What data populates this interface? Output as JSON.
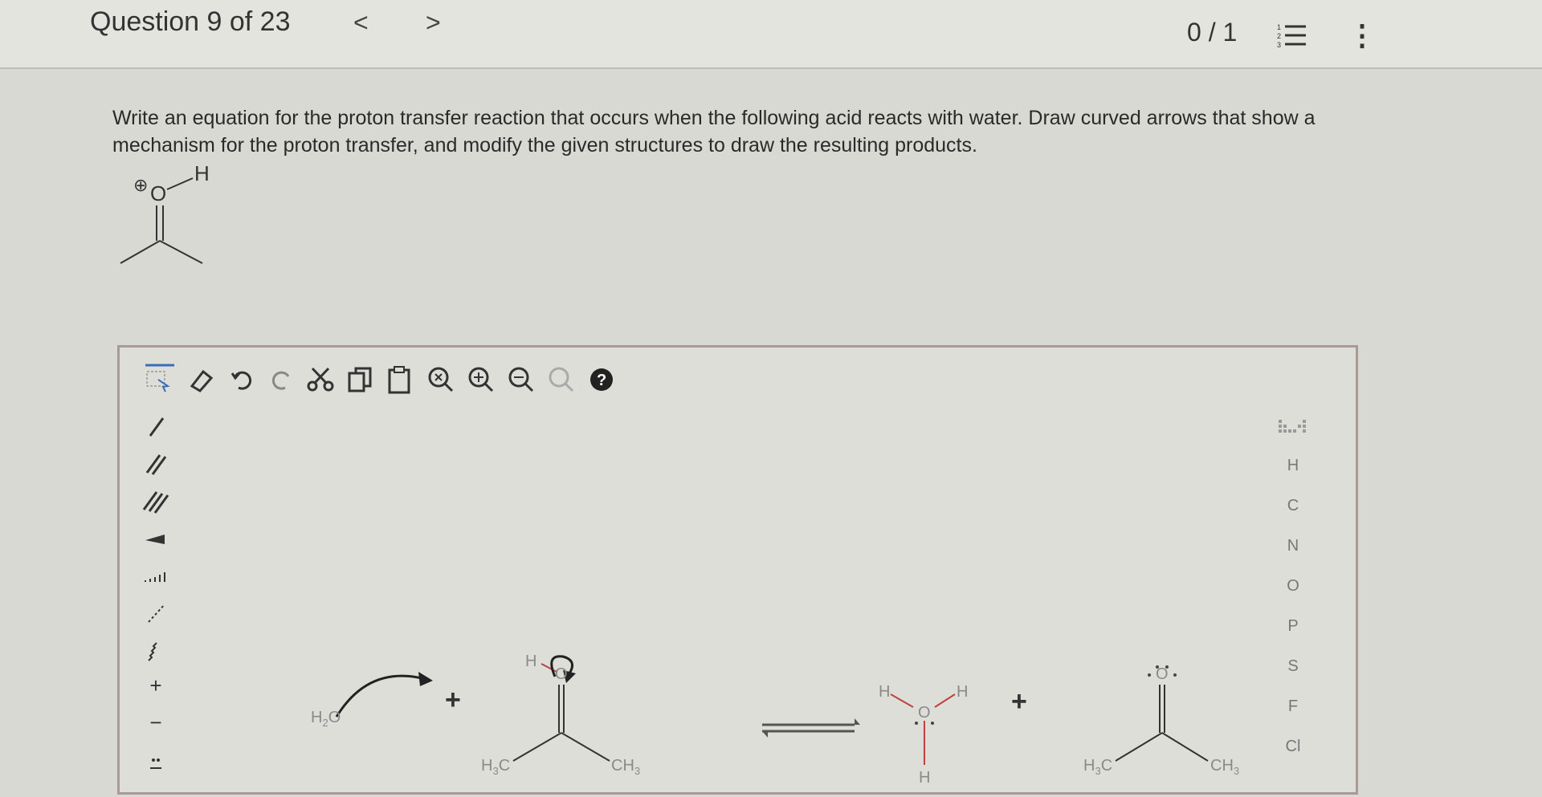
{
  "header": {
    "question_counter": "Question 9 of 23",
    "prev_label": "<",
    "next_label": ">",
    "score": "0 / 1",
    "list_icon": "list-icon",
    "more_icon": "more-vertical-icon"
  },
  "question": {
    "text": "Write an equation for the proton transfer reaction that occurs when the following acid reacts with water. Draw curved arrows that show a mechanism for the proton transfer, and modify the given structures to draw the resulting products."
  },
  "molecule": {
    "charge": "⊕",
    "oxygen": "O",
    "hydrogen": "H"
  },
  "toolbar": {
    "icons": [
      "select-lasso-icon",
      "eraser-icon",
      "undo-icon",
      "redo-icon",
      "cut-icon",
      "copy-icon",
      "paste-icon",
      "zoom-reset-icon",
      "zoom-in-icon",
      "zoom-out-icon",
      "zoom-fit-icon",
      "help-icon"
    ]
  },
  "left_tools": {
    "icons": [
      "single-bond-icon",
      "double-bond-icon",
      "triple-bond-icon",
      "wedge-bond-icon",
      "hash-bond-icon",
      "dashed-bond-icon",
      "wavy-bond-icon",
      "positive-charge-icon",
      "negative-charge-icon",
      "lone-pair-icon"
    ],
    "plus_label": "+",
    "minus_label": "−"
  },
  "elements": {
    "periodic_icon": "periodic-table-icon",
    "list": [
      "H",
      "C",
      "N",
      "O",
      "P",
      "S",
      "F",
      "Cl"
    ]
  },
  "canvas": {
    "water_label": "H",
    "water_sub": "2",
    "water_o": "O",
    "plus1": "+",
    "plus2": "+",
    "reactant_h": "H",
    "reactant_o": "O",
    "reactant_left": "H",
    "reactant_left_sub": "3",
    "reactant_left_c": "C",
    "reactant_right": "CH",
    "reactant_right_sub": "3",
    "hydronium_h1": "H",
    "hydronium_h2": "H",
    "hydronium_h3": "H",
    "hydronium_o": "O",
    "product_o": "O",
    "product_left": "H",
    "product_left_sub": "3",
    "product_left_c": "C",
    "product_right": "CH",
    "product_right_sub": "3"
  }
}
